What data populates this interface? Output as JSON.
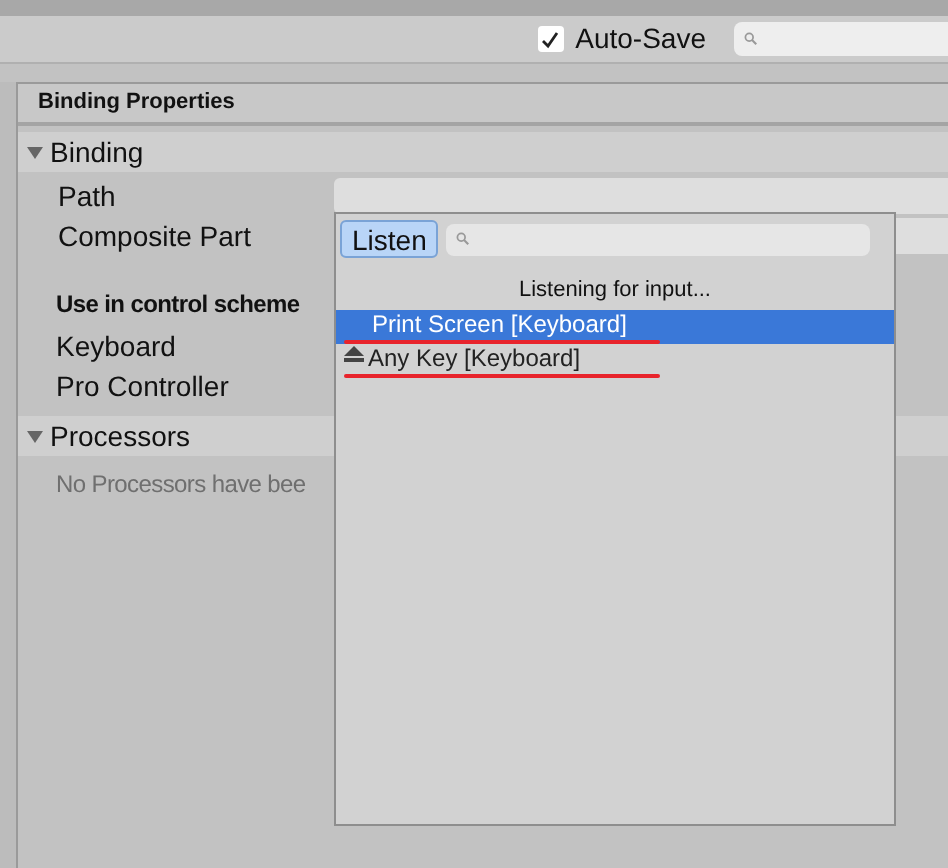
{
  "toolbar": {
    "auto_save": {
      "label": "Auto-Save",
      "checked": true
    }
  },
  "panel": {
    "title": "Binding Properties",
    "sections": [
      {
        "title": "Binding",
        "expanded": true,
        "fields": [
          {
            "label": "Path"
          },
          {
            "label": "Composite Part"
          }
        ],
        "scheme_heading": "Use in control scheme",
        "schemes": [
          "Keyboard",
          "Pro Controller"
        ]
      },
      {
        "title": "Processors",
        "expanded": true,
        "empty_text": "No Processors have bee"
      }
    ]
  },
  "popup": {
    "listen_button": {
      "label": "Listen",
      "selected": true
    },
    "status": "Listening for input...",
    "items": [
      {
        "label": "Print Screen [Keyboard]",
        "selected": true,
        "struck": true
      },
      {
        "label": "Any Key [Keyboard]",
        "selected": false,
        "struck": true
      }
    ]
  }
}
